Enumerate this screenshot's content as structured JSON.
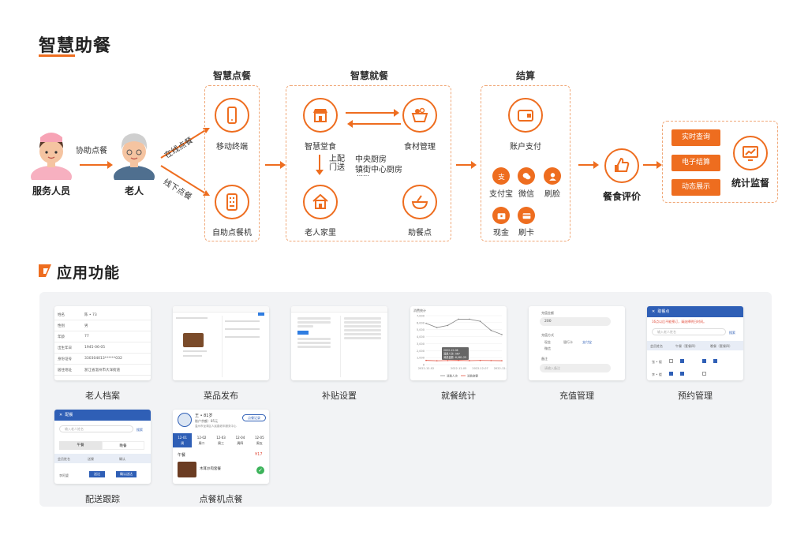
{
  "titles": {
    "main": "智慧助餐",
    "app": "应用功能"
  },
  "flow": {
    "staff": "服务人员",
    "assist_order": "协助点餐",
    "elder": "老人",
    "online_order": "在线点餐",
    "offline_order": "线下点餐",
    "ordering": {
      "title": "智慧点餐",
      "mobile": "移动终端",
      "kiosk": "自助点餐机"
    },
    "dining": {
      "title": "智慧就餐",
      "canteen": "智慧堂食",
      "ingredients": "食材管理",
      "delivery_v": "上配门送",
      "kitchen1": "中央厨房",
      "kitchen2": "镇街中心厨房",
      "dots": "……",
      "home": "老人家里",
      "meal_point": "助餐点"
    },
    "settlement": {
      "title": "结算",
      "account": "账户支付",
      "alipay": "支付宝",
      "wechat": "微信",
      "face": "刷脸",
      "cash": "现金",
      "card": "刷卡"
    },
    "evaluation": "餐食评价",
    "monitor": {
      "realtime": "实时查询",
      "e_settle": "电子结算",
      "dynamic": "动态展示",
      "label": "统计监督"
    }
  },
  "apps": [
    {
      "caption": "老人档案"
    },
    {
      "caption": "菜品发布"
    },
    {
      "caption": "补贴设置"
    },
    {
      "caption": "就餐统计"
    },
    {
      "caption": "充值管理"
    },
    {
      "caption": "预约管理"
    },
    {
      "caption": "配送跟踪"
    },
    {
      "caption": "点餐机点餐"
    }
  ],
  "profile_rows": [
    {
      "k": "姓名",
      "v": "陈 • 73"
    },
    {
      "k": "性别",
      "v": "男"
    },
    {
      "k": "年龄",
      "v": "77"
    },
    {
      "k": "出生年日",
      "v": "1945-06-05"
    },
    {
      "k": "身份证号",
      "v": "330304013******032"
    },
    {
      "k": "居住地址",
      "v": "浙江省温州市大洋街道"
    }
  ],
  "recharge": {
    "amount_label": "充值金额",
    "amount": "200",
    "method_label": "充值方式",
    "m1": "现金",
    "m2": "银行卡",
    "m3": "支付宝",
    "m4": "微信",
    "remark_label": "备注",
    "remark_ph": "请输入备注"
  },
  "reservation": {
    "header": "助餐点",
    "notice": "16点以后不能预订，请选择明日时间。",
    "search_ph": "输入老人姓名",
    "search_btn": "搜索",
    "col1": "会员姓名",
    "col2": "午餐（套餐四）",
    "col3": "晚餐（套餐四）",
    "r1": "张 • 楼",
    "r2": "李 • 楼"
  },
  "delivery_app": {
    "header": "配餐",
    "search_ph": "输入老人姓名",
    "search_btn": "搜索",
    "tab1": "午餐",
    "tab2": "晚餐",
    "col1": "会员姓名",
    "col2": "送餐",
    "col3": "确认",
    "name": "李阿婆",
    "b1": "送达",
    "b2": "确认送达"
  },
  "kiosk_app": {
    "name": "王 • 81岁",
    "balance": "账户余额：85元",
    "address": "温州市龙湾区人民路老年服务中心",
    "btn": "点餐记录",
    "days": [
      "12-01\n周",
      "12-02\n周二",
      "12-03\n周三",
      "12-04\n周四",
      "12-05\n周五"
    ],
    "meal": "午餐",
    "price": "¥17",
    "dish": "木耳炒肉套餐"
  },
  "stats_chart": {
    "title": "消费统计",
    "tooltip_date": "2022-12-06",
    "tooltip_1": "消费人次: 567",
    "tooltip_2": "消费金额: 6,081.25",
    "legend1": "消费人次",
    "legend2": "消费金额"
  },
  "chart_data": {
    "type": "line",
    "title": "消费统计",
    "x": [
      "2022-12-02",
      "2022-12-03",
      "2022-12-04",
      "2022-12-05",
      "2022-12-06",
      "2022-12-07",
      "2022-12-08",
      "2022-12-09"
    ],
    "ylim": [
      0,
      7000
    ],
    "series": [
      {
        "name": "消费人次",
        "values": [
          5900,
          5300,
          5600,
          6500,
          6500,
          6200,
          4900,
          4300
        ]
      },
      {
        "name": "消费金额",
        "values": [
          600,
          550,
          580,
          600,
          567,
          590,
          580,
          560
        ]
      }
    ],
    "yticks": [
      "7,000",
      "6,000",
      "5,000",
      "4,000",
      "3,000",
      "2,000",
      "1,000",
      "0"
    ],
    "xticks": [
      "2022-12-02",
      "2022-12-05",
      "2022-12-07",
      "2022-12-09"
    ]
  },
  "colors": {
    "accent": "#ee6d1f",
    "blue": "#2f5fb6"
  }
}
